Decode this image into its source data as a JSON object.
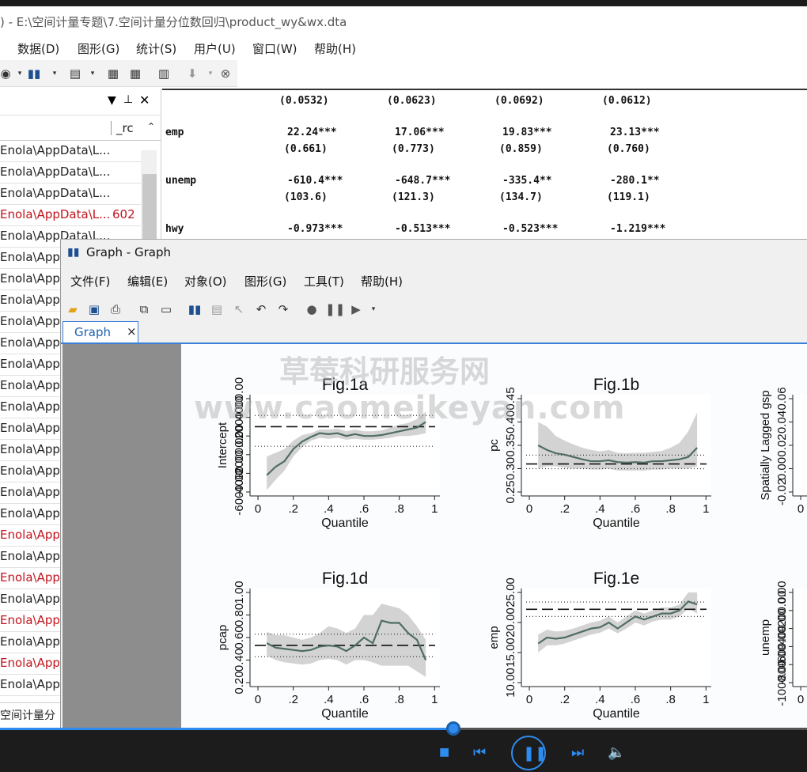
{
  "window": {
    "title": ") - E:\\空间计量专题\\7.空间计量分位数回归\\product_wy&wx.dta"
  },
  "menu": [
    "数据(D)",
    "图形(G)",
    "统计(S)",
    "用户(U)",
    "窗口(W)",
    "帮助(H)"
  ],
  "history": {
    "varname_header": "_rc",
    "rows": [
      {
        "text": "Enola\\AppData\\L...",
        "rc": "",
        "error": false
      },
      {
        "text": "Enola\\AppData\\L...",
        "rc": "",
        "error": false
      },
      {
        "text": "Enola\\AppData\\L...",
        "rc": "",
        "error": false
      },
      {
        "text": "Enola\\AppData\\L...",
        "rc": "602",
        "error": true
      },
      {
        "text": "Enola\\AppData\\L...",
        "rc": "",
        "error": false
      },
      {
        "text": "Enola\\App",
        "rc": "",
        "error": false
      },
      {
        "text": "Enola\\App",
        "rc": "",
        "error": false
      },
      {
        "text": "Enola\\App",
        "rc": "",
        "error": false
      },
      {
        "text": "Enola\\App",
        "rc": "",
        "error": false
      },
      {
        "text": "Enola\\App",
        "rc": "",
        "error": false
      },
      {
        "text": "Enola\\App",
        "rc": "",
        "error": false
      },
      {
        "text": "Enola\\App",
        "rc": "",
        "error": false
      },
      {
        "text": "Enola\\App",
        "rc": "",
        "error": false
      },
      {
        "text": "Enola\\App",
        "rc": "",
        "error": false
      },
      {
        "text": "Enola\\App",
        "rc": "",
        "error": false
      },
      {
        "text": "Enola\\App",
        "rc": "",
        "error": false
      },
      {
        "text": "Enola\\App",
        "rc": "",
        "error": false
      },
      {
        "text": "Enola\\App",
        "rc": "",
        "error": false
      },
      {
        "text": "Enola\\App",
        "rc": "",
        "error": true
      },
      {
        "text": "Enola\\App",
        "rc": "",
        "error": false
      },
      {
        "text": "Enola\\App",
        "rc": "",
        "error": true
      },
      {
        "text": "Enola\\App",
        "rc": "",
        "error": false
      },
      {
        "text": "Enola\\App",
        "rc": "",
        "error": true
      },
      {
        "text": "Enola\\App",
        "rc": "",
        "error": false
      },
      {
        "text": "Enola\\App",
        "rc": "",
        "error": true
      },
      {
        "text": "Enola\\App",
        "rc": "",
        "error": false
      }
    ],
    "footer": "空间计量分"
  },
  "results": {
    "se_top": [
      "(0.0532)",
      "(0.0623)",
      "(0.0692)",
      "(0.0612)"
    ],
    "rows": [
      {
        "name": "emp",
        "coef": [
          "22.24***",
          "17.06***",
          "19.83***",
          "23.13***"
        ],
        "se": [
          "(0.661)",
          "(0.773)",
          "(0.859)",
          "(0.760)"
        ]
      },
      {
        "name": "unemp",
        "coef": [
          "-610.4***",
          "-648.7***",
          "-335.4**",
          "-280.1**"
        ],
        "se": [
          "(103.6)",
          "(121.3)",
          "(134.7)",
          "(119.1)"
        ]
      },
      {
        "name": "hwy",
        "coef": [
          "-0.973***",
          "-0.513***",
          "-0.523***",
          "-1.219***"
        ],
        "se": []
      }
    ]
  },
  "graph_window": {
    "title": "Graph - Graph",
    "menu": [
      "文件(F)",
      "编辑(E)",
      "对象(O)",
      "图形(G)",
      "工具(T)",
      "帮助(H)"
    ],
    "tab_label": "Graph",
    "tab_close": "×"
  },
  "watermark": {
    "line1": "草莓科研服务网",
    "line2": "www.caomeikeyan.com"
  },
  "player": {
    "progress": 0.562
  },
  "chart_data": [
    {
      "type": "line",
      "title": "Fig.1a",
      "xlabel": "Quantile",
      "ylabel": "Intercept",
      "xticks": [
        "0",
        ".2",
        ".4",
        ".6",
        ".8",
        "1"
      ],
      "yticks": [
        "-6000.00",
        "-4000.00",
        "-2000.00",
        "0.00",
        "2000.00",
        "4000.00"
      ],
      "ylim": [
        -6000,
        4000
      ],
      "x": [
        0.05,
        0.1,
        0.15,
        0.2,
        0.25,
        0.3,
        0.35,
        0.4,
        0.45,
        0.5,
        0.55,
        0.6,
        0.65,
        0.7,
        0.75,
        0.8,
        0.85,
        0.9,
        0.95
      ],
      "series": [
        {
          "values": [
            -4200,
            -3300,
            -2700,
            -1400,
            -600,
            -100,
            300,
            200,
            300,
            0,
            200,
            0,
            0,
            100,
            300,
            500,
            700,
            900,
            1500
          ],
          "lower": [
            -5800,
            -4700,
            -3700,
            -2200,
            -1200,
            -500,
            -200,
            -300,
            -200,
            -400,
            -300,
            -400,
            -400,
            -300,
            -200,
            0,
            0,
            100,
            300
          ],
          "upper": [
            -2200,
            -1800,
            -1400,
            -500,
            100,
            300,
            700,
            700,
            800,
            500,
            700,
            500,
            500,
            600,
            900,
            1200,
            1400,
            1800,
            2600
          ]
        }
      ],
      "ref_line": 1000,
      "ref_ci": [
        -1100,
        2200
      ]
    },
    {
      "type": "line",
      "title": "Fig.1b",
      "xlabel": "Quantile",
      "ylabel": "pc",
      "xticks": [
        "0",
        ".2",
        ".4",
        ".6",
        ".8",
        "1"
      ],
      "yticks": [
        "0.25",
        "0.30",
        "0.35",
        "0.40",
        "0.45"
      ],
      "ylim": [
        0.25,
        0.45
      ],
      "x": [
        0.05,
        0.1,
        0.15,
        0.2,
        0.25,
        0.3,
        0.35,
        0.4,
        0.45,
        0.5,
        0.55,
        0.6,
        0.65,
        0.7,
        0.75,
        0.8,
        0.85,
        0.9,
        0.95
      ],
      "series": [
        {
          "values": [
            0.35,
            0.34,
            0.333,
            0.33,
            0.325,
            0.32,
            0.316,
            0.316,
            0.318,
            0.314,
            0.313,
            0.314,
            0.313,
            0.316,
            0.316,
            0.318,
            0.32,
            0.325,
            0.345
          ],
          "lower": [
            0.3,
            0.305,
            0.305,
            0.302,
            0.3,
            0.3,
            0.298,
            0.298,
            0.3,
            0.296,
            0.296,
            0.296,
            0.296,
            0.298,
            0.298,
            0.3,
            0.3,
            0.3,
            0.305
          ],
          "upper": [
            0.4,
            0.39,
            0.37,
            0.36,
            0.352,
            0.345,
            0.34,
            0.337,
            0.34,
            0.334,
            0.333,
            0.334,
            0.334,
            0.336,
            0.338,
            0.345,
            0.355,
            0.38,
            0.42
          ]
        }
      ],
      "ref_line": 0.31,
      "ref_ci": [
        0.3,
        0.329
      ]
    },
    {
      "type": "line",
      "title": "",
      "xlabel": "",
      "ylabel": "Spatially Lagged gsp",
      "xticks": [
        "0"
      ],
      "yticks": [
        "-0.02",
        "0.00",
        "0.02",
        "0.04",
        "0.06"
      ],
      "ylim": [
        -0.02,
        0.06
      ],
      "x": [],
      "series": []
    },
    {
      "type": "line",
      "title": "Fig.1d",
      "xlabel": "Quantile",
      "ylabel": "pcap",
      "xticks": [
        "0",
        ".2",
        ".4",
        ".6",
        ".8",
        "1"
      ],
      "yticks": [
        "0.20",
        "0.40",
        "0.60",
        "0.80",
        "1.00"
      ],
      "ylim": [
        0.2,
        1.0
      ],
      "x": [
        0.05,
        0.1,
        0.15,
        0.2,
        0.25,
        0.3,
        0.35,
        0.4,
        0.45,
        0.5,
        0.55,
        0.6,
        0.65,
        0.7,
        0.75,
        0.8,
        0.85,
        0.9,
        0.95
      ],
      "series": [
        {
          "values": [
            0.55,
            0.51,
            0.5,
            0.49,
            0.48,
            0.49,
            0.52,
            0.53,
            0.52,
            0.48,
            0.53,
            0.6,
            0.55,
            0.75,
            0.73,
            0.73,
            0.64,
            0.58,
            0.4
          ],
          "lower": [
            0.44,
            0.4,
            0.38,
            0.37,
            0.36,
            0.37,
            0.4,
            0.41,
            0.4,
            0.36,
            0.4,
            0.4,
            0.38,
            0.35,
            0.35,
            0.35,
            0.35,
            0.3,
            0.25
          ],
          "upper": [
            0.65,
            0.62,
            0.62,
            0.6,
            0.58,
            0.6,
            0.64,
            0.7,
            0.68,
            0.64,
            0.68,
            0.8,
            0.8,
            0.9,
            0.88,
            0.86,
            0.8,
            0.7,
            0.58
          ]
        }
      ],
      "ref_line": 0.53,
      "ref_ci": [
        0.43,
        0.63
      ]
    },
    {
      "type": "line",
      "title": "Fig.1e",
      "xlabel": "Quantile",
      "ylabel": "emp",
      "xticks": [
        "0",
        ".2",
        ".4",
        ".6",
        ".8",
        "1"
      ],
      "yticks": [
        "10.00",
        "15.00",
        "20.00",
        "25.00"
      ],
      "ylim": [
        10,
        25
      ],
      "x": [
        0.05,
        0.1,
        0.15,
        0.2,
        0.25,
        0.3,
        0.35,
        0.4,
        0.45,
        0.5,
        0.55,
        0.6,
        0.65,
        0.7,
        0.75,
        0.8,
        0.85,
        0.9,
        0.95
      ],
      "series": [
        {
          "values": [
            16.5,
            17.5,
            17.3,
            17.5,
            18.0,
            18.5,
            19.0,
            19.2,
            20.0,
            19.0,
            20.0,
            21.0,
            20.5,
            21.0,
            21.5,
            21.5,
            22.0,
            23.5,
            23.0
          ],
          "lower": [
            15.0,
            16.2,
            16.2,
            16.5,
            17.0,
            17.5,
            18.0,
            18.3,
            19.0,
            18.2,
            19.0,
            20.0,
            19.5,
            20.2,
            20.5,
            20.5,
            21.0,
            22.3,
            21.5
          ],
          "upper": [
            18.0,
            18.8,
            18.5,
            18.6,
            19.0,
            19.5,
            20.0,
            20.3,
            21.0,
            20.0,
            21.0,
            22.0,
            21.5,
            22.0,
            22.5,
            22.5,
            23.0,
            25.0,
            25.0
          ]
        }
      ],
      "ref_line": 22.2,
      "ref_ci": [
        21.0,
        23.4
      ]
    },
    {
      "type": "line",
      "title": "",
      "xlabel": "",
      "ylabel": "unemp",
      "xticks": [
        "0"
      ],
      "yticks": [
        "-1000.00",
        "-800.00",
        "-600.00",
        "-400.00",
        "-200.00",
        "0.00"
      ],
      "ylim": [
        -1000,
        0
      ],
      "x": [],
      "series": []
    }
  ]
}
